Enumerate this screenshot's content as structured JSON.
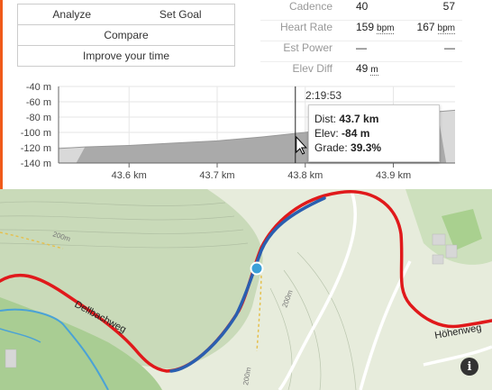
{
  "actions": {
    "analyze": "Analyze",
    "set_goal": "Set Goal",
    "compare": "Compare",
    "improve": "Improve your time"
  },
  "stats": [
    {
      "label": "Cadence",
      "v1": "40",
      "v1_unit": "",
      "v2": "57",
      "v2_unit": ""
    },
    {
      "label": "Heart Rate",
      "v1": "159",
      "v1_unit": "bpm",
      "v2": "167",
      "v2_unit": "bpm"
    },
    {
      "label": "Est Power",
      "v1": "—",
      "v1_unit": "",
      "v2": "—",
      "v2_unit": ""
    },
    {
      "label": "Elev Diff",
      "v1": "49",
      "v1_unit": "m",
      "v2": "",
      "v2_unit": ""
    }
  ],
  "chart_data": {
    "type": "area",
    "x": [
      43.52,
      43.55,
      43.6,
      43.65,
      43.7,
      43.75,
      43.8,
      43.85,
      43.9,
      43.95,
      43.97
    ],
    "y": [
      -121,
      -119,
      -117,
      -114,
      -111,
      -106,
      -100,
      -93,
      -85,
      -73,
      -71
    ],
    "x_ticks": [
      "43.6 km",
      "43.7 km",
      "43.8 km",
      "43.9 km"
    ],
    "y_ticks": [
      "-40 m",
      "-60 m",
      "-80 m",
      "-100 m",
      "-120 m",
      "-140 m"
    ],
    "xlim": [
      43.52,
      43.97
    ],
    "ylim": [
      -140,
      -40
    ],
    "highlight_range": [
      43.54,
      43.96
    ],
    "cursor_x": 43.8
  },
  "cursor": {
    "time": "2:19:53",
    "dist_label": "Dist:",
    "dist_value": "43.7 km",
    "elev_label": "Elev:",
    "elev_value": "-84 m",
    "grade_label": "Grade:",
    "grade_value": "39.3%"
  },
  "map": {
    "road_dellbach": "Dellbachweg",
    "road_hohen": "Höhenweg",
    "contour_1": "200m",
    "contour_2": "200m",
    "contour_3": "200m",
    "info_icon": "i",
    "colors": {
      "route": "#e0191b",
      "segment": "#2a5fb0",
      "marker": "#3aa0d8"
    }
  }
}
